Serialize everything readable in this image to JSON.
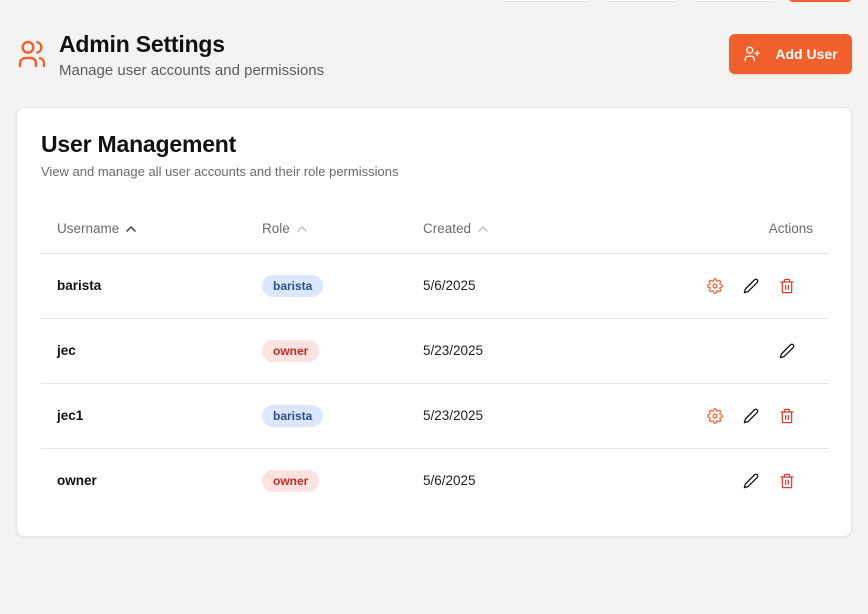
{
  "header": {
    "title": "Admin Settings",
    "subtitle": "Manage user accounts and permissions",
    "add_user_label": "Add User",
    "icon": "users-icon"
  },
  "card": {
    "title": "User Management",
    "description": "View and manage all user accounts and their role permissions"
  },
  "table": {
    "columns": {
      "username": "Username",
      "role": "Role",
      "created": "Created",
      "actions": "Actions"
    },
    "rows": [
      {
        "username": "barista",
        "role": "barista",
        "created": "5/6/2025",
        "actions": [
          "settings",
          "edit",
          "delete"
        ]
      },
      {
        "username": "jec",
        "role": "owner",
        "created": "5/23/2025",
        "actions": [
          "edit"
        ]
      },
      {
        "username": "jec1",
        "role": "barista",
        "created": "5/23/2025",
        "actions": [
          "settings",
          "edit",
          "delete"
        ]
      },
      {
        "username": "owner",
        "role": "owner",
        "created": "5/6/2025",
        "actions": [
          "edit",
          "delete"
        ]
      }
    ]
  },
  "colors": {
    "accent": "#f15f2c",
    "barista_badge_bg": "#dbe7fb",
    "barista_badge_text": "#2c4f8f",
    "owner_badge_bg": "#fde2e1",
    "owner_badge_text": "#c02a25",
    "delete_icon": "#d93b33"
  }
}
